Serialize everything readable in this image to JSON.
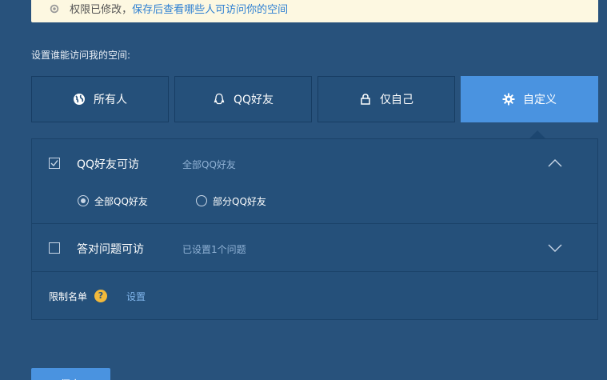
{
  "notice": {
    "text_prefix": "权限已修改，",
    "link_text": "保存后查看哪些人可访问你的空间"
  },
  "section_label": "设置谁能访问我的空间:",
  "options": [
    {
      "label": "所有人",
      "icon": "globe-icon"
    },
    {
      "label": "QQ好友",
      "icon": "qq-penguin-icon"
    },
    {
      "label": "仅自己",
      "icon": "lock-icon"
    },
    {
      "label": "自定义",
      "icon": "gear-icon",
      "selected": true
    }
  ],
  "panel": {
    "qq_friends": {
      "title": "QQ好友可访",
      "desc": "全部QQ好友",
      "checked": true,
      "expanded": true,
      "radio_all": "全部QQ好友",
      "radio_partial": "部分QQ好友",
      "selected_radio": "全部QQ好友"
    },
    "question": {
      "title": "答对问题可访",
      "desc": "已设置1个问题",
      "checked": false,
      "expanded": false
    },
    "limit": {
      "label": "限制名单",
      "help": "?",
      "link": "设置"
    }
  },
  "save_label": "保存",
  "colors": {
    "background": "#28527c",
    "accent": "#4a93e0",
    "notice_bg": "#fdf8e1",
    "help_badge": "#f2b93b"
  }
}
